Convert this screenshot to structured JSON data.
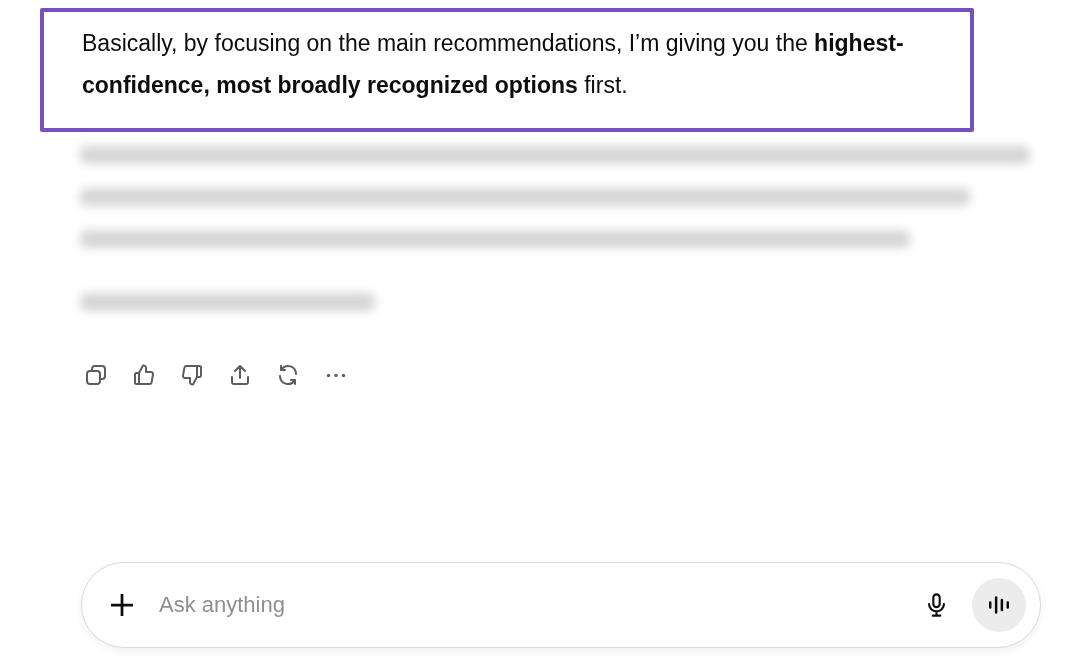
{
  "message": {
    "text": "Basically, by focusing on the main recommendations, I’m giving you the **highest-confidence, most broadly recognized options** first.",
    "highlighted": true
  },
  "composer": {
    "placeholder": "Ask anything"
  }
}
